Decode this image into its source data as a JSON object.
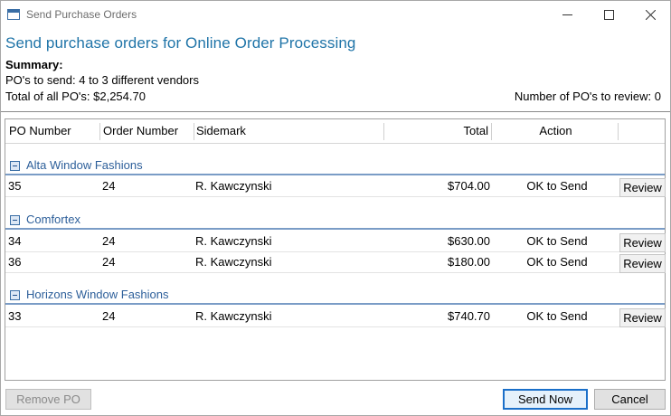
{
  "window": {
    "title": "Send Purchase Orders"
  },
  "heading": "Send purchase orders for Online Order Processing",
  "summary": {
    "title": "Summary:",
    "line1": "PO's to send: 4 to 3 different vendors",
    "line2": "Total of all PO's: $2,254.70",
    "review_count": "Number of PO's to review: 0"
  },
  "grid": {
    "columns": [
      "PO Number",
      "Order Number",
      "Sidemark",
      "Total",
      "Action"
    ],
    "groups": [
      {
        "name": "Alta Window Fashions",
        "rows": [
          {
            "po": "35",
            "order": "24",
            "sidemark": "R. Kawczynski",
            "total": "$704.00",
            "action": "OK to Send",
            "button": "Review"
          }
        ]
      },
      {
        "name": "Comfortex",
        "rows": [
          {
            "po": "34",
            "order": "24",
            "sidemark": "R. Kawczynski",
            "total": "$630.00",
            "action": "OK to Send",
            "button": "Review"
          },
          {
            "po": "36",
            "order": "24",
            "sidemark": "R. Kawczynski",
            "total": "$180.00",
            "action": "OK to Send",
            "button": "Review"
          }
        ]
      },
      {
        "name": "Horizons Window Fashions",
        "rows": [
          {
            "po": "33",
            "order": "24",
            "sidemark": "R. Kawczynski",
            "total": "$740.70",
            "action": "OK to Send",
            "button": "Review"
          }
        ]
      }
    ]
  },
  "buttons": {
    "remove": "Remove PO",
    "send": "Send Now",
    "cancel": "Cancel"
  },
  "colors": {
    "heading": "#1f74a8",
    "group_label": "#2d5f9a",
    "default_button_border": "#1a6fc9"
  }
}
